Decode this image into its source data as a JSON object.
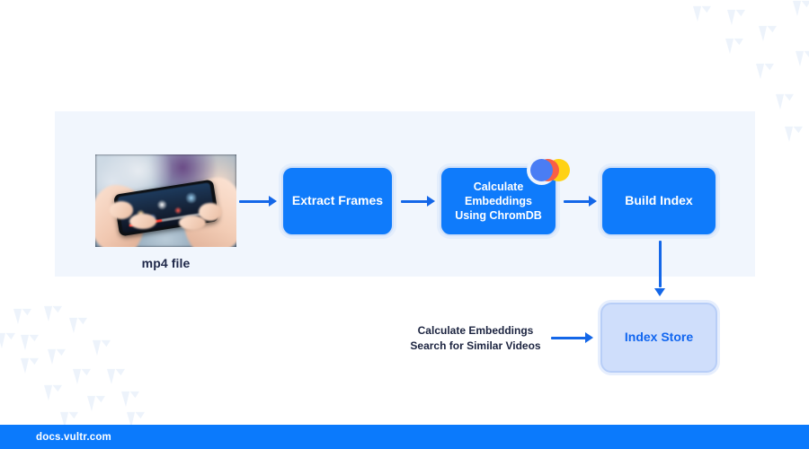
{
  "colors": {
    "accent_blue": "#0f7bfb",
    "arrow_blue": "#1467e8",
    "panel_bg": "#f1f6fd",
    "light_node_bg": "#cfdefb",
    "light_node_text": "#1166f0",
    "footer_bg": "#0b7afc",
    "label_text": "#20294a",
    "watermark": "#dfeaf9",
    "chroma_blue": "#4a7df4",
    "chroma_red": "#f95f46",
    "chroma_yellow": "#ffd215"
  },
  "diagram": {
    "input": {
      "image_alt": "hands-holding-smartphone-playing-video",
      "label": "mp4 file"
    },
    "nodes": [
      {
        "id": "extract",
        "label": "Extract Frames",
        "style": "solid"
      },
      {
        "id": "chroma",
        "label_line1": "Calculate Embeddings",
        "label_line2": "Using ChromDB",
        "style": "solid",
        "badge": "chromadb-logo"
      },
      {
        "id": "build",
        "label": "Build Index",
        "style": "solid"
      },
      {
        "id": "store",
        "label": "Index Store",
        "style": "light"
      }
    ],
    "query": {
      "line1": "Calculate Embeddings",
      "line2": "Search for Similar Videos"
    },
    "arrows": [
      {
        "id": "arrow-1",
        "from": "mp4-file",
        "to": "extract",
        "direction": "right"
      },
      {
        "id": "arrow-2",
        "from": "extract",
        "to": "chroma",
        "direction": "right"
      },
      {
        "id": "arrow-3",
        "from": "chroma",
        "to": "build",
        "direction": "right"
      },
      {
        "id": "arrow-4",
        "from": "query",
        "to": "store",
        "direction": "right"
      },
      {
        "id": "arrow-5",
        "from": "build",
        "to": "store",
        "direction": "down"
      }
    ]
  },
  "footer": {
    "text": "docs.vultr.com"
  }
}
